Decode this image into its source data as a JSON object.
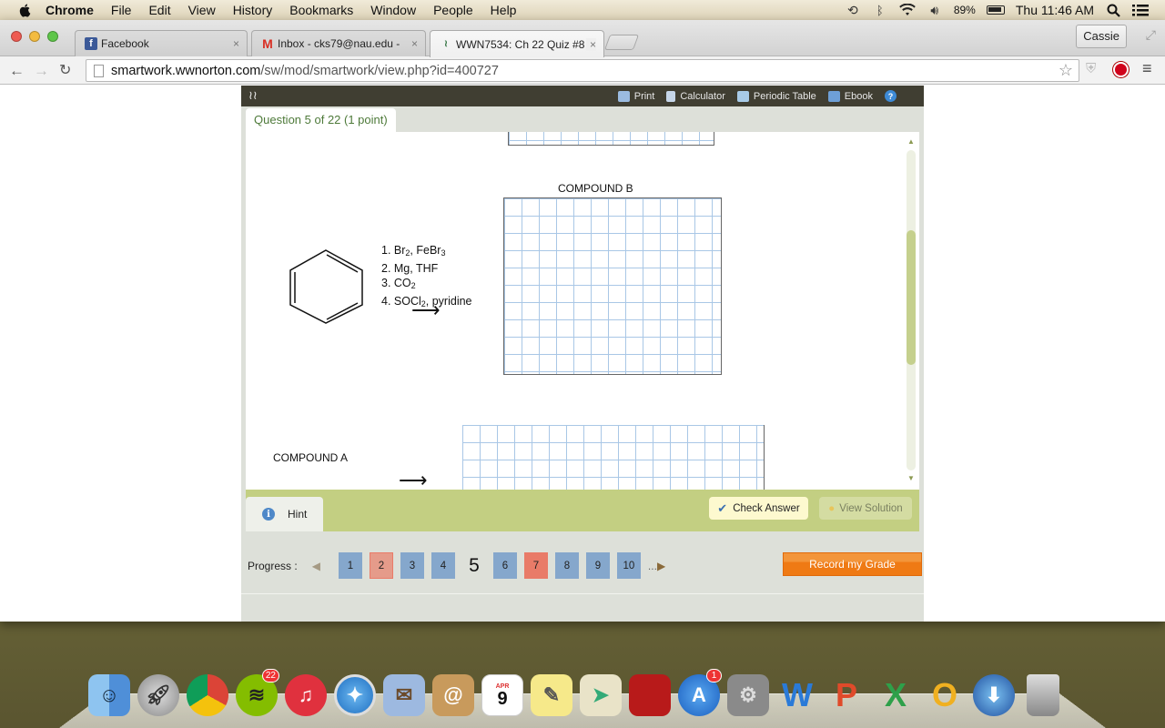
{
  "menubar": {
    "app_name": "Chrome",
    "items": [
      "File",
      "Edit",
      "View",
      "History",
      "Bookmarks",
      "Window",
      "People",
      "Help"
    ],
    "battery": "89%",
    "clock": "Thu 11:46 AM",
    "status_icons": [
      "time-machine-icon",
      "bluetooth-icon",
      "wifi-icon",
      "volume-icon",
      "battery-icon",
      "spotlight-icon",
      "notification-center-icon"
    ]
  },
  "browser": {
    "tabs": [
      {
        "title": "Facebook",
        "favicon": "facebook-icon",
        "active": false
      },
      {
        "title": "Inbox - cks79@nau.edu - ",
        "favicon": "gmail-icon",
        "active": false
      },
      {
        "title": "WWN7534: Ch 22 Quiz #8",
        "favicon": "norton-icon",
        "active": true
      }
    ],
    "profile_name": "Cassie",
    "url_host": "smartwork.wwnorton.com",
    "url_path": "/sw/mod/smartwork/view.php?id=400727"
  },
  "app": {
    "toolbar": {
      "print": "Print",
      "calculator": "Calculator",
      "periodic_table": "Periodic Table",
      "ebook": "Ebook"
    },
    "question_label": "Question 5 of 22 (1 point)",
    "problem": {
      "reagents": [
        {
          "n": "1.",
          "parts": [
            "Br",
            "2",
            ", FeBr",
            "3",
            ""
          ]
        },
        {
          "n": "2.",
          "parts": [
            "Mg, THF"
          ]
        },
        {
          "n": "3.",
          "parts": [
            "CO",
            "2"
          ]
        },
        {
          "n": "4.",
          "parts": [
            "SOCl",
            "2",
            ", pyridine"
          ]
        }
      ],
      "reagent_lines": [
        "1. Br2, FeBr3",
        "2. Mg, THF",
        "3. CO2",
        "4. SOCl2, pyridine"
      ],
      "compound_b_label": "COMPOUND B",
      "compound_a_label": "COMPOUND A",
      "arrow": "⟶"
    },
    "actions": {
      "hint": "Hint",
      "check_answer": "Check Answer",
      "view_solution": "View Solution"
    },
    "progress": {
      "label": "Progress :",
      "current": "5",
      "items": [
        {
          "num": "1",
          "status": "answered",
          "color": "#85a7cc"
        },
        {
          "num": "2",
          "status": "incorrect-partial",
          "color": "#e59b8a"
        },
        {
          "num": "3",
          "status": "answered",
          "color": "#85a7cc"
        },
        {
          "num": "4",
          "status": "answered",
          "color": "#85a7cc"
        },
        {
          "num": "5",
          "status": "current",
          "color": null
        },
        {
          "num": "6",
          "status": "answered",
          "color": "#85a7cc"
        },
        {
          "num": "7",
          "status": "incorrect",
          "color": "#e97b68"
        },
        {
          "num": "8",
          "status": "answered",
          "color": "#85a7cc"
        },
        {
          "num": "9",
          "status": "answered",
          "color": "#85a7cc"
        },
        {
          "num": "10",
          "status": "answered",
          "color": "#85a7cc"
        }
      ],
      "more": "...",
      "record_grade": "Record my Grade"
    },
    "colors": {
      "toolbar_bg": "#403e32",
      "accent_green": "#c3cf82",
      "record_orange": "#ef7a14",
      "question_label_green": "#4e7a3a"
    }
  },
  "dock": {
    "apps": [
      {
        "name": "Finder",
        "icon": "finder-icon"
      },
      {
        "name": "Launchpad",
        "icon": "launchpad-icon"
      },
      {
        "name": "Chrome",
        "icon": "chrome-icon"
      },
      {
        "name": "Spotify",
        "icon": "spotify-icon",
        "badge": "22"
      },
      {
        "name": "iTunes",
        "icon": "itunes-icon"
      },
      {
        "name": "Safari",
        "icon": "safari-icon"
      },
      {
        "name": "Mail",
        "icon": "mail-icon"
      },
      {
        "name": "Contacts",
        "icon": "contacts-icon"
      },
      {
        "name": "Calendar",
        "icon": "calendar-icon",
        "month": "APR",
        "day": "9"
      },
      {
        "name": "Notes",
        "icon": "notes-icon"
      },
      {
        "name": "Maps",
        "icon": "maps-icon"
      },
      {
        "name": "Photo Booth",
        "icon": "photo-booth-icon"
      },
      {
        "name": "App Store",
        "icon": "app-store-icon",
        "badge": "1"
      },
      {
        "name": "System Preferences",
        "icon": "system-preferences-icon"
      },
      {
        "name": "Word",
        "icon": "word-icon"
      },
      {
        "name": "PowerPoint",
        "icon": "powerpoint-icon"
      },
      {
        "name": "Excel",
        "icon": "excel-icon"
      },
      {
        "name": "Outlook",
        "icon": "outlook-icon"
      },
      {
        "name": "Migration",
        "icon": "download-globe-icon"
      },
      {
        "name": "Trash",
        "icon": "trash-icon"
      }
    ]
  }
}
